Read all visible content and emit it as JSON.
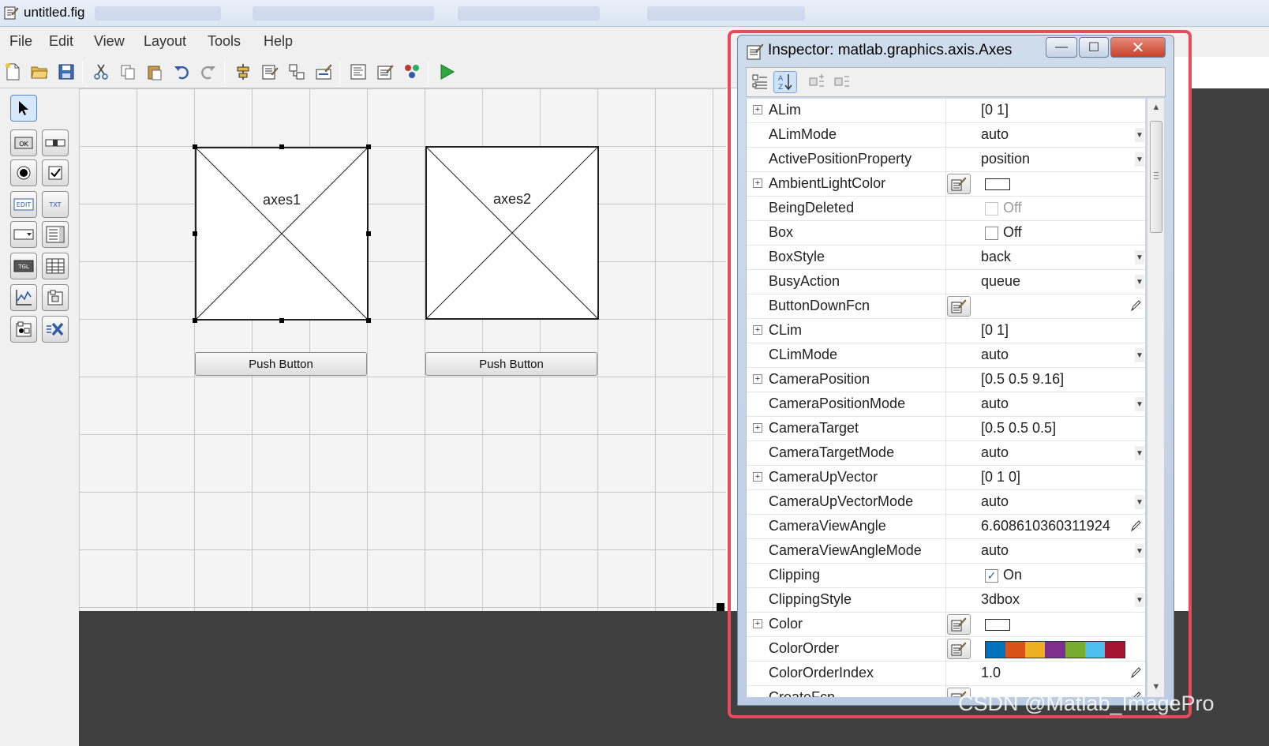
{
  "window": {
    "title": "untitled.fig"
  },
  "menu": [
    "File",
    "Edit",
    "View",
    "Layout",
    "Tools",
    "Help"
  ],
  "toolbar_icons": [
    "new-file-icon",
    "open-folder-icon",
    "save-icon",
    "cut-icon",
    "copy-icon",
    "paste-icon",
    "undo-icon",
    "redo-icon",
    "align-icon",
    "menu-editor-icon",
    "tab-order-icon",
    "toolbar-editor-icon",
    "editor-icon",
    "property-inspector-icon",
    "object-browser-icon",
    "run-icon"
  ],
  "palette": [
    {
      "icon": "select-arrow-icon",
      "text": ""
    },
    {
      "icon": "push-button-icon",
      "text": "OK"
    },
    {
      "icon": "slider-icon",
      "text": ""
    },
    {
      "icon": "radio-button-icon",
      "text": ""
    },
    {
      "icon": "checkbox-icon",
      "text": ""
    },
    {
      "icon": "edit-text-icon",
      "text": "EDIT"
    },
    {
      "icon": "static-text-icon",
      "text": "TXT"
    },
    {
      "icon": "popup-menu-icon",
      "text": ""
    },
    {
      "icon": "listbox-icon",
      "text": ""
    },
    {
      "icon": "toggle-button-icon",
      "text": "TGL"
    },
    {
      "icon": "table-icon",
      "text": ""
    },
    {
      "icon": "axes-icon",
      "text": ""
    },
    {
      "icon": "panel-icon",
      "text": ""
    },
    {
      "icon": "button-group-icon",
      "text": ""
    },
    {
      "icon": "activex-icon",
      "text": ""
    }
  ],
  "canvas": {
    "axes": [
      {
        "label": "axes1",
        "selected": true
      },
      {
        "label": "axes2",
        "selected": false
      }
    ],
    "buttons": [
      "Push Button",
      "Push Button"
    ]
  },
  "inspector": {
    "title": "Inspector:  matlab.graphics.axis.Axes",
    "window_buttons": {
      "minimize": "—",
      "maximize": "☐",
      "close": "✕"
    },
    "properties": [
      {
        "name": "ALim",
        "value": "[0 1]",
        "expand": true
      },
      {
        "name": "ALimMode",
        "value": "auto",
        "dropdown": true
      },
      {
        "name": "ActivePositionProperty",
        "value": "position",
        "dropdown": true
      },
      {
        "name": "AmbientLightColor",
        "value": "",
        "expand": true,
        "button": true,
        "swatch": true
      },
      {
        "name": "BeingDeleted",
        "value": "Off",
        "checkbox": true,
        "checked": false,
        "disabled": true
      },
      {
        "name": "Box",
        "value": "Off",
        "checkbox": true,
        "checked": false
      },
      {
        "name": "BoxStyle",
        "value": "back",
        "dropdown": true
      },
      {
        "name": "BusyAction",
        "value": "queue",
        "dropdown": true
      },
      {
        "name": "ButtonDownFcn",
        "value": "",
        "button": true,
        "pencil": true
      },
      {
        "name": "CLim",
        "value": "[0 1]",
        "expand": true
      },
      {
        "name": "CLimMode",
        "value": "auto",
        "dropdown": true
      },
      {
        "name": "CameraPosition",
        "value": "[0.5 0.5 9.16]",
        "expand": true
      },
      {
        "name": "CameraPositionMode",
        "value": "auto",
        "dropdown": true
      },
      {
        "name": "CameraTarget",
        "value": "[0.5 0.5 0.5]",
        "expand": true
      },
      {
        "name": "CameraTargetMode",
        "value": "auto",
        "dropdown": true
      },
      {
        "name": "CameraUpVector",
        "value": "[0 1 0]",
        "expand": true
      },
      {
        "name": "CameraUpVectorMode",
        "value": "auto",
        "dropdown": true
      },
      {
        "name": "CameraViewAngle",
        "value": "6.608610360311924",
        "pencil": true
      },
      {
        "name": "CameraViewAngleMode",
        "value": "auto",
        "dropdown": true
      },
      {
        "name": "Clipping",
        "value": "On",
        "checkbox": true,
        "checked": true
      },
      {
        "name": "ClippingStyle",
        "value": "3dbox",
        "dropdown": true
      },
      {
        "name": "Color",
        "value": "",
        "expand": true,
        "button": true,
        "swatch": true
      },
      {
        "name": "ColorOrder",
        "value": "",
        "button": true,
        "colororder": [
          "#0072bd",
          "#d95319",
          "#edb120",
          "#7e2f8e",
          "#77ac30",
          "#4dbeee",
          "#a2142f"
        ]
      },
      {
        "name": "ColorOrderIndex",
        "value": "1.0",
        "pencil": true
      },
      {
        "name": "CreateFcn",
        "value": "",
        "button": true,
        "pencil": true
      }
    ]
  },
  "watermark": "CSDN @Matlab_ImagePro",
  "colors": {
    "accent_outline": "#ea4a5e",
    "dark_bg": "#3f3f3f",
    "run_green": "#2ea83a"
  }
}
